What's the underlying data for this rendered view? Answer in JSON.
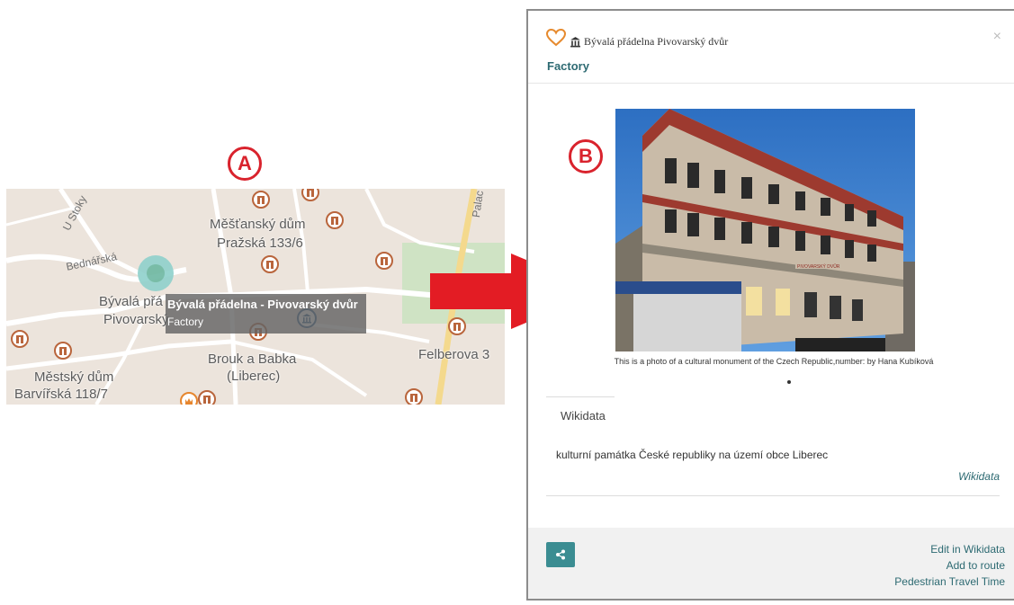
{
  "annotations": {
    "a": "A",
    "b": "B"
  },
  "map": {
    "labels": {
      "mestansky_dum": "Měšťanský dům",
      "prazska": "Pražská 133/6",
      "byvala_partial": "Bývalá přá",
      "pivovarsky_partial": "Pivovarský",
      "brouk": "Brouk a Babka",
      "liberec": "(Liberec)",
      "felberova": "Felberova 3",
      "mestsky_dum": "Městský dům",
      "barvirska": "Barvířská 118/7"
    },
    "streets": {
      "u_stoky": "U Stoky",
      "bednarska": "Bednářská",
      "palac": "Palac"
    },
    "tooltip": {
      "title": "Bývalá přádelna - Pivovarský dvůr",
      "type": "Factory"
    }
  },
  "popup": {
    "title": "Bývalá přádelna   Pivovarský dvůr",
    "subtitle": "Factory",
    "close": "×",
    "sign_text": "PIVOVARSKÝ DVŮR",
    "caption": "This is a photo of a cultural monument of the Czech Republic,number: by Hana Kubíková",
    "tab": "Wikidata",
    "description": "kulturní památka České republiky na území obce Liberec",
    "wikidata_link": "Wikidata",
    "footer": {
      "edit": "Edit in Wikidata",
      "add_route": "Add to route",
      "travel_time": "Pedestrian Travel Time"
    }
  },
  "colors": {
    "accent": "#d9232d",
    "teal": "#2d6a72",
    "button": "#3b8d92"
  }
}
